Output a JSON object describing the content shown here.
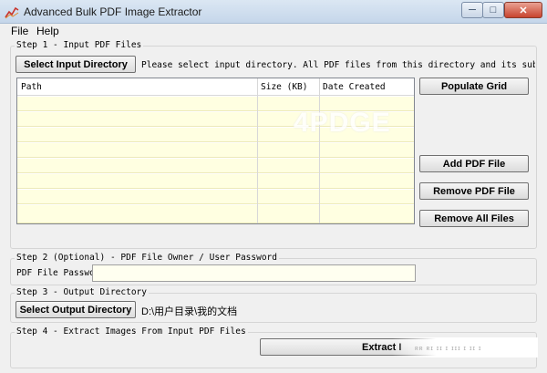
{
  "window": {
    "title": "Advanced Bulk PDF Image Extractor",
    "min_glyph": "─",
    "max_glyph": "□",
    "close_glyph": "✕"
  },
  "menu": {
    "file": "File",
    "help": "Help"
  },
  "step1": {
    "label": "Step 1 - Input PDF Files",
    "select_button": "Select Input Directory",
    "hint": "Please select input directory. All PDF files from this directory and its subdirectori",
    "grid": {
      "columns": [
        "Path",
        "Size (KB)",
        "Date Created"
      ],
      "rows": 8
    },
    "populate_button": "Populate Grid",
    "add_button": "Add PDF File",
    "remove_button": "Remove PDF File",
    "remove_all_button": "Remove All Files",
    "watermark": "4PDGE"
  },
  "step2": {
    "label": "Step 2 (Optional) - PDF File Owner / User Password",
    "password_label": "PDF File Password:",
    "password_value": ""
  },
  "step3": {
    "label": "Step 3 - Output Directory",
    "select_button": "Select Output Directory",
    "path": "D:\\用户目录\\我的文档"
  },
  "step4": {
    "label": "Step 4 - Extract Images From Input PDF Files",
    "extract_button": "Extract I",
    "watermark": "ʀʀ ʀɪ ɪɪ ɪ ɪɪɪ ɪ ɪɪ ɪ"
  }
}
